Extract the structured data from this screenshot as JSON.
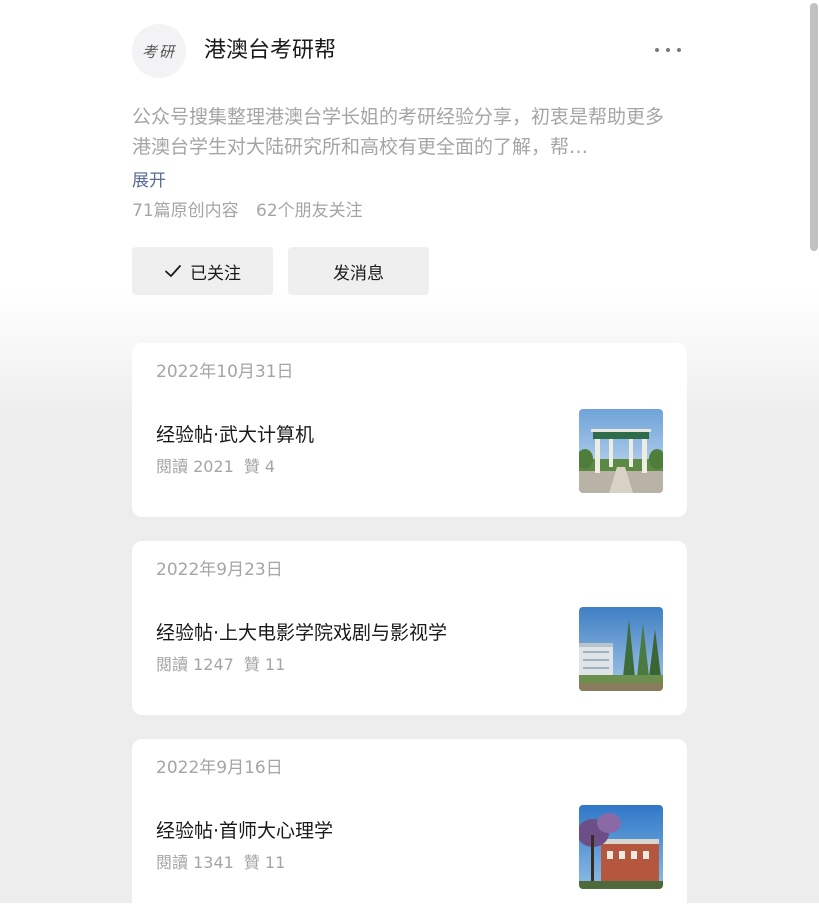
{
  "account": {
    "avatar_text": "考研",
    "name": "港澳台考研帮",
    "description": "公众号搜集整理港澳台学长姐的考研经验分享，初衷是帮助更多港澳台学生对大陆研究所和高校有更全面的了解，帮…",
    "expand_label": "展开",
    "original_count": "71篇原创内容",
    "friends_following": "62个朋友关注"
  },
  "buttons": {
    "follow_label": "已关注",
    "message_label": "发消息"
  },
  "articles": [
    {
      "date": "2022年10月31日",
      "title": "经验帖·武大计算机",
      "reads": "閱讀 2021",
      "likes": "贊 4",
      "thumbnail_icon": "university-gate-image"
    },
    {
      "date": "2022年9月23日",
      "title": "经验帖·上大电影学院戏剧与影视学",
      "reads": "閱讀 1247",
      "likes": "贊 11",
      "thumbnail_icon": "campus-building-trees-image"
    },
    {
      "date": "2022年9月16日",
      "title": "经验帖·首师大心理学",
      "reads": "閱讀 1341",
      "likes": "贊 11",
      "thumbnail_icon": "campus-building-blossom-image"
    }
  ],
  "colors": {
    "link": "#576b95",
    "muted_text": "#a5a5a5",
    "button_bg": "#efefef",
    "page_bg": "#ededed"
  }
}
